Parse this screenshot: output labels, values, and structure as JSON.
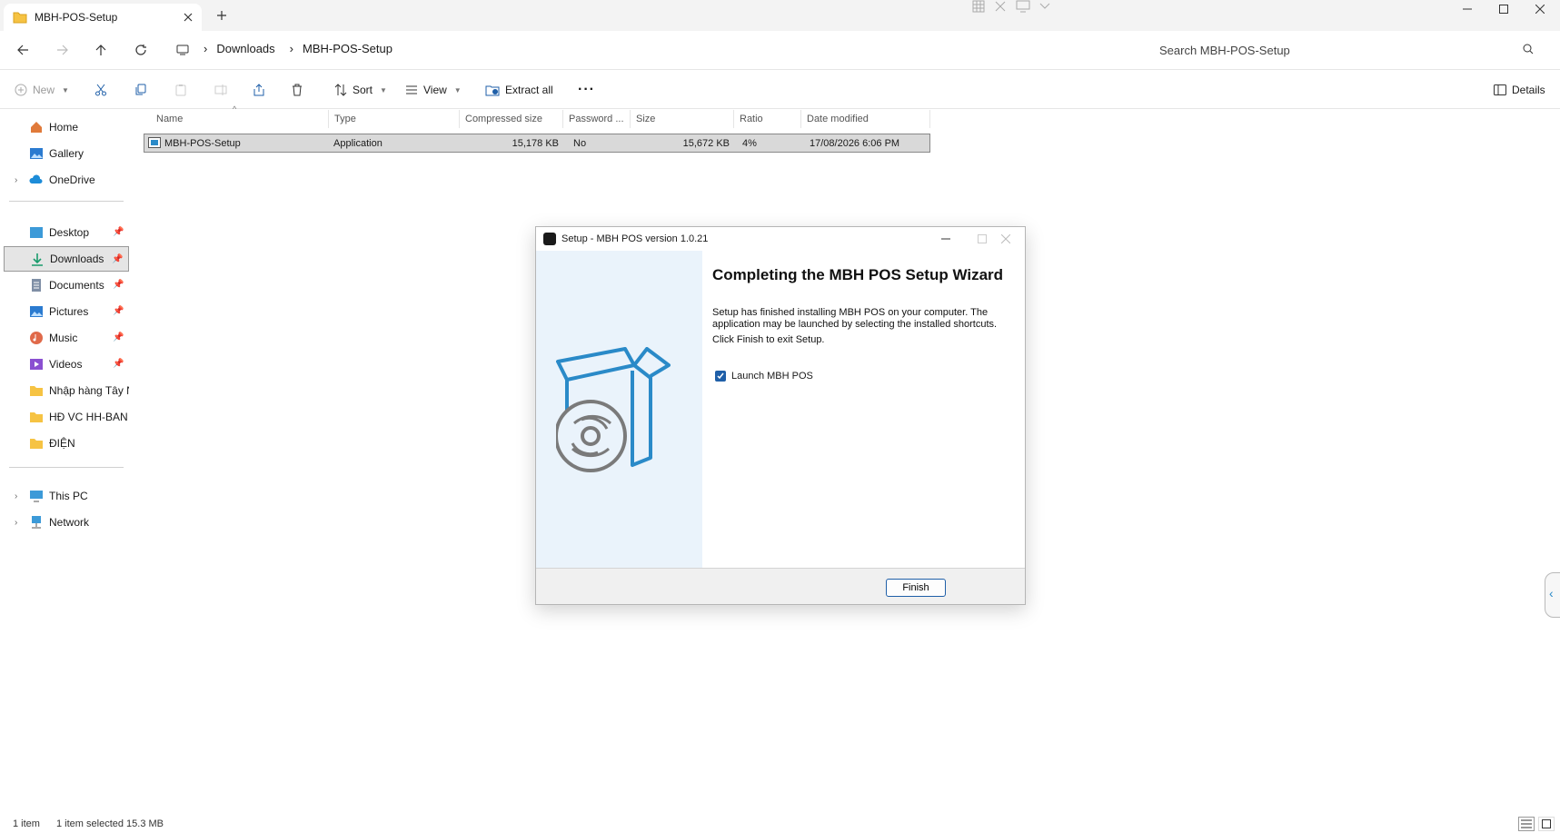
{
  "window": {
    "tab_title": "MBH-POS-Setup"
  },
  "address": {
    "crumbs": [
      "Downloads",
      "MBH-POS-Setup"
    ],
    "search_placeholder": "Search MBH-POS-Setup"
  },
  "toolbar": {
    "new_label": "New",
    "sort_label": "Sort",
    "view_label": "View",
    "extract_label": "Extract all",
    "details_label": "Details"
  },
  "sidebar": {
    "items": [
      {
        "label": "Home",
        "icon": "home-icon"
      },
      {
        "label": "Gallery",
        "icon": "gallery-icon"
      },
      {
        "label": "OneDrive",
        "icon": "cloud-icon"
      },
      {
        "label": "Desktop",
        "icon": "desktop-icon"
      },
      {
        "label": "Downloads",
        "icon": "download-icon"
      },
      {
        "label": "Documents",
        "icon": "document-icon"
      },
      {
        "label": "Pictures",
        "icon": "pictures-icon"
      },
      {
        "label": "Music",
        "icon": "music-icon"
      },
      {
        "label": "Videos",
        "icon": "videos-icon"
      },
      {
        "label": "Nhập hàng Tây Nar",
        "icon": "folder-icon"
      },
      {
        "label": "HĐ VC HH-BAN CH",
        "icon": "folder-icon"
      },
      {
        "label": "ĐIỆN",
        "icon": "folder-icon"
      },
      {
        "label": "This PC",
        "icon": "pc-icon"
      },
      {
        "label": "Network",
        "icon": "network-icon"
      }
    ]
  },
  "filelist": {
    "columns": [
      "Name",
      "Type",
      "Compressed size",
      "Password ...",
      "Size",
      "Ratio",
      "Date modified"
    ],
    "rows": [
      {
        "name": "MBH-POS-Setup",
        "type": "Application",
        "compressed": "15,178 KB",
        "password": "No",
        "size": "15,672 KB",
        "ratio": "4%",
        "date": "17/08/2026 6:06 PM"
      }
    ]
  },
  "dialog": {
    "title": "Setup - MBH POS version 1.0.21",
    "heading": "Completing the MBH POS Setup Wizard",
    "text1": "Setup has finished installing MBH POS on your computer. The application may be launched by selecting the installed shortcuts.",
    "text2": "Click Finish to exit Setup.",
    "checkbox_label": "Launch MBH POS",
    "checkbox_checked": true,
    "finish_label": "Finish"
  },
  "status": {
    "count": "1 item",
    "selection": "1 item selected  15.3 MB"
  },
  "colors": {
    "accent": "#1f5fa8",
    "wizard_blue": "#2a8ac8",
    "selected_row": "#d9d9d9"
  }
}
